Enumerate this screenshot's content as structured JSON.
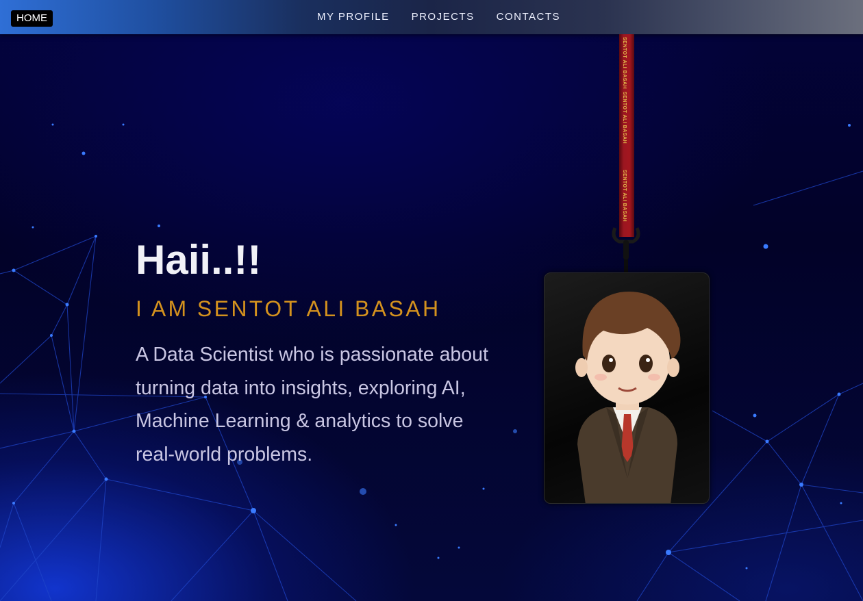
{
  "nav": {
    "home_label": "HOME",
    "links": [
      "MY PROFILE",
      "PROJECTS",
      "CONTACTS"
    ]
  },
  "hero": {
    "greeting": "Haii..!!",
    "name_line": "I AM SENTOT ALI BASAH",
    "description": "A Data Scientist who is passionate about turning data into insights, exploring AI, Machine Learning & analytics to solve real-world problems."
  },
  "lanyard": {
    "text": "SENTOT ALI BASAH"
  },
  "colors": {
    "accent_gold": "#d4921e",
    "lanyard_red": "#a3161f",
    "background": "#02022a"
  }
}
